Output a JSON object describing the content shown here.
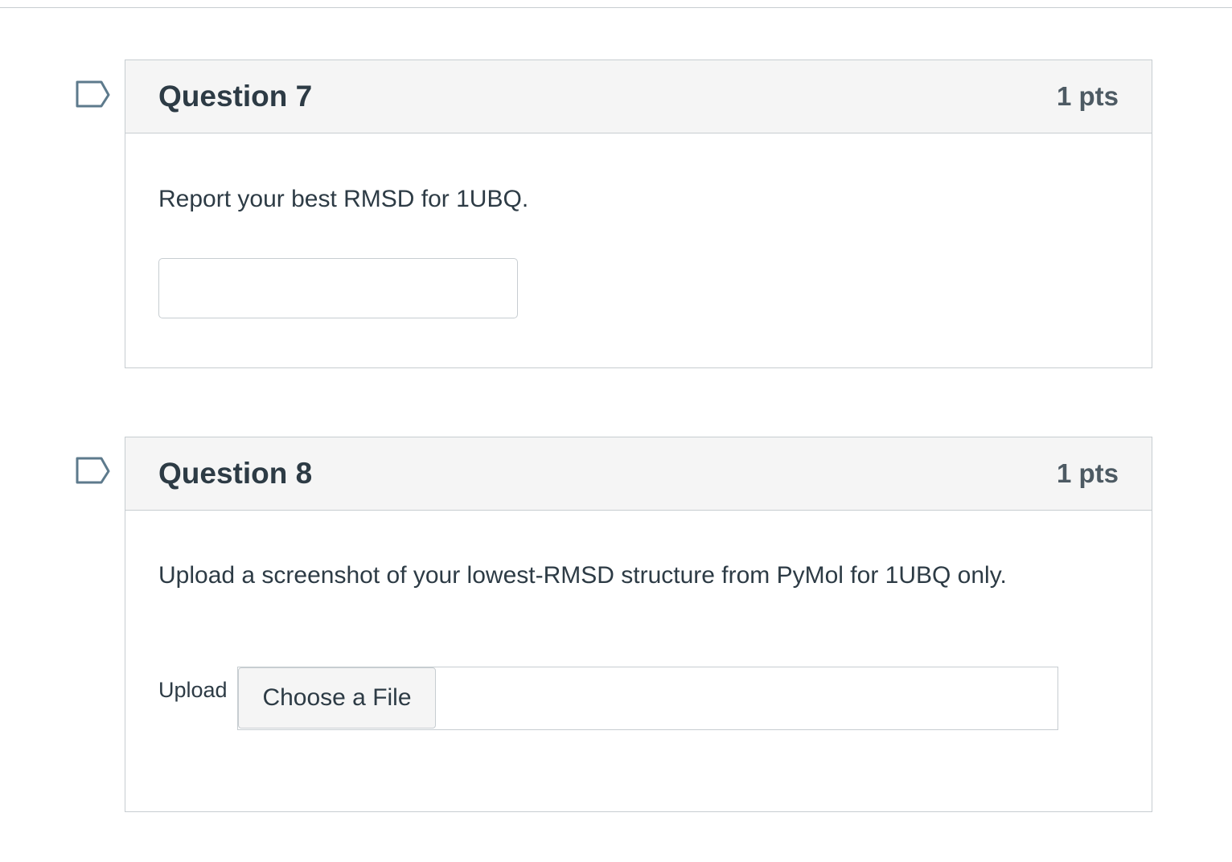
{
  "questions": [
    {
      "title": "Question 7",
      "points": "1 pts",
      "prompt": "Report your best RMSD for 1UBQ.",
      "answer_value": ""
    },
    {
      "title": "Question 8",
      "points": "1 pts",
      "prompt": "Upload a screenshot of your lowest-RMSD structure from PyMol for 1UBQ only.",
      "upload_label": "Upload",
      "choose_file_label": "Choose a File"
    }
  ],
  "icons": {
    "flag": "bookmark-flag-icon"
  },
  "colors": {
    "border": "#c7cdd1",
    "header_bg": "#f5f5f5",
    "text": "#2d3b45",
    "flag_stroke": "#5d7a8c"
  }
}
